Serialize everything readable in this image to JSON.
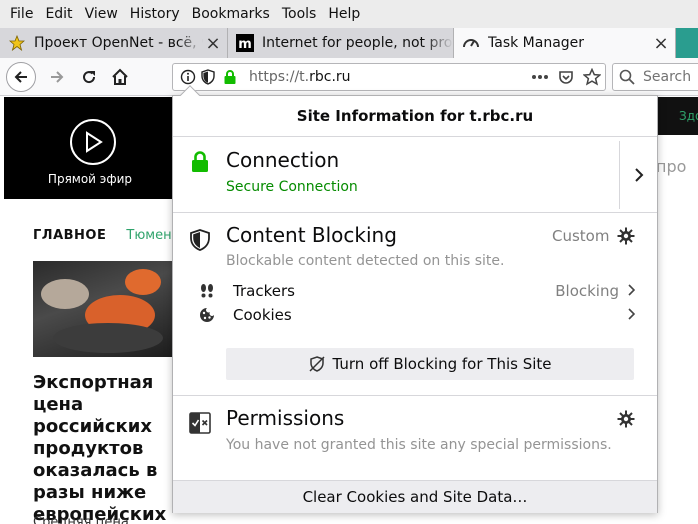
{
  "menu": [
    "File",
    "Edit",
    "View",
    "History",
    "Bookmarks",
    "Tools",
    "Help"
  ],
  "tabs": [
    {
      "title": "Проект OpenNet - всё, что",
      "icon": "star-icon"
    },
    {
      "title": "Internet for people, not profit",
      "icon": "mozilla-m-icon"
    },
    {
      "title": "Task Manager",
      "icon": "gauge-icon"
    }
  ],
  "tab_close": "×",
  "url": {
    "prefix": "https://t.",
    "domain": "rbc.ru"
  },
  "search_placeholder": "Search",
  "page": {
    "live_label": "Прямой эфир",
    "dark_strip_text": "Здо",
    "side_fragment": "про",
    "nav_main": "ГЛАВНОЕ",
    "nav_city": "Тюмень",
    "headline": "Экспортная цена российских продуктов оказалась в разы ниже европейских",
    "lead": "Средняя цена"
  },
  "popup": {
    "title": "Site Information for t.rbc.ru",
    "connection": {
      "heading": "Connection",
      "status": "Secure Connection"
    },
    "content_blocking": {
      "heading": "Content Blocking",
      "mode": "Custom",
      "description": "Blockable content detected on this site.",
      "trackers_label": "Trackers",
      "trackers_status": "Blocking",
      "cookies_label": "Cookies",
      "turn_off_label": "Turn off Blocking for This Site"
    },
    "permissions": {
      "heading": "Permissions",
      "description": "You have not granted this site any special permissions."
    },
    "clear_label": "Clear Cookies and Site Data…"
  },
  "colors": {
    "secure_green": "#12bc00",
    "link_green": "#058b00",
    "muted": "#808080"
  }
}
